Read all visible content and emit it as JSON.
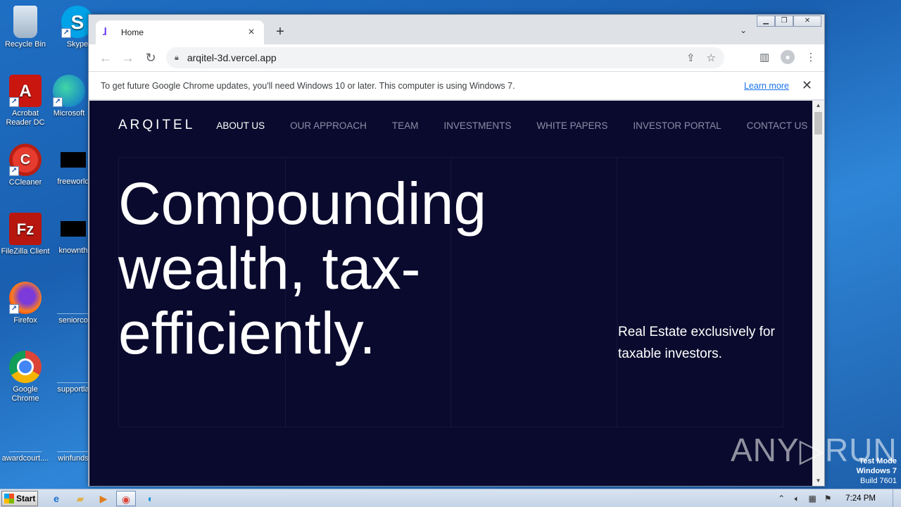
{
  "desktop": {
    "icons": [
      {
        "label": "Recycle Bin",
        "glyph": ""
      },
      {
        "label": "Skype",
        "glyph": "S"
      },
      {
        "label": "Acrobat Reader DC",
        "glyph": "A"
      },
      {
        "label": "Microsoft",
        "glyph": "e"
      },
      {
        "label": "CCleaner",
        "glyph": "C"
      },
      {
        "label": "freeworld",
        "glyph": ""
      },
      {
        "label": "FileZilla Client",
        "glyph": "Fz"
      },
      {
        "label": "knownth",
        "glyph": ""
      },
      {
        "label": "Firefox",
        "glyph": ""
      },
      {
        "label": "seniorco",
        "glyph": ""
      },
      {
        "label": "Google Chrome",
        "glyph": ""
      },
      {
        "label": "supportla",
        "glyph": ""
      },
      {
        "label": "awardcourt....",
        "glyph": ""
      },
      {
        "label": "winfunds",
        "glyph": ""
      }
    ]
  },
  "browser": {
    "tab": {
      "title": "Home",
      "favicon": "ɺ"
    },
    "url": "arqitel-3d.vercel.app",
    "infobar": {
      "message": "To get future Google Chrome updates, you'll need Windows 10 or later. This computer is using Windows 7.",
      "link": "Learn more"
    }
  },
  "site": {
    "logo": "ARQITEL",
    "nav": [
      {
        "label": "ABOUT US",
        "active": true
      },
      {
        "label": "OUR APPROACH",
        "active": false
      },
      {
        "label": "TEAM",
        "active": false
      },
      {
        "label": "INVESTMENTS",
        "active": false
      },
      {
        "label": "WHITE PAPERS",
        "active": false
      },
      {
        "label": "INVESTOR PORTAL",
        "active": false
      },
      {
        "label": "CONTACT US",
        "active": false
      }
    ],
    "hero_title": "Compounding wealth, tax-efficiently.",
    "hero_subtitle": "Real Estate exclusively for taxable investors."
  },
  "overlay": {
    "watermark": "ANY▷RUN",
    "test_mode": "Test Mode",
    "os": "Windows 7",
    "build": "Build 7601"
  },
  "taskbar": {
    "start_label": "Start",
    "clock": "7:24 PM"
  },
  "colors": {
    "page_background": "#0a0a2e",
    "nav_inactive": "#8c8ca8",
    "accent_link": "#1a73e8"
  }
}
